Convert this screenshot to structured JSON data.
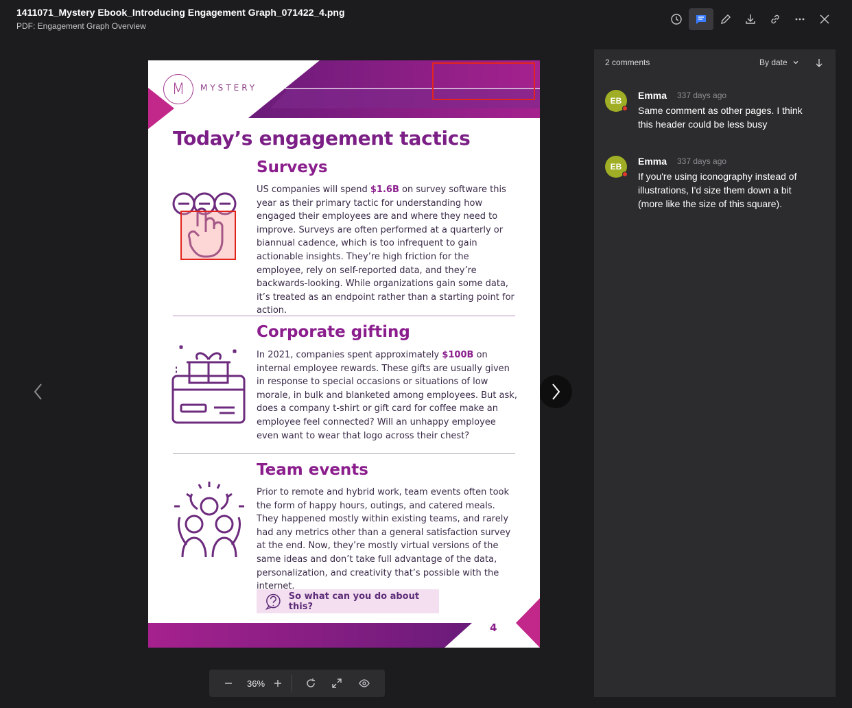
{
  "header": {
    "title": "1411071_Mystery Ebook_Introducing Engagement Graph_071422_4.png",
    "subtitle": "PDF: Engagement Graph Overview",
    "actions": [
      "history-icon",
      "comments-icon",
      "edit-icon",
      "download-icon",
      "link-icon",
      "more-icon",
      "close-icon"
    ]
  },
  "document": {
    "logo_letter": "M",
    "logo_text": "MYSTERY",
    "heading": "Today’s engagement tactics",
    "sections": [
      {
        "title": "Surveys",
        "body_before": "US companies will spend ",
        "highlight": "$1.6B",
        "body_after": " on survey software this year as their primary tactic for understanding how engaged their employees are and where they need to improve. Surveys are often performed at a quarterly or biannual cadence, which is too infrequent to gain actionable insights. They’re high friction for the employee, rely on self-reported data, and they’re backwards-looking. While organizations gain some data, it’s treated as an endpoint rather than a starting point for action."
      },
      {
        "title": "Corporate gifting",
        "body_before": "In 2021, companies spent approximately ",
        "highlight": "$100B",
        "body_after": " on internal employee rewards. These gifts are usually given in response to special occasions or situations of low morale, in bulk and blanketed among employees. But ask, does a company t-shirt or gift card for coffee make an employee feel connected? Will an unhappy employee even want to wear that logo across their chest?"
      },
      {
        "title": "Team events",
        "body": "Prior to remote and hybrid work, team events often took the form of happy hours, outings, and catered meals. They happened mostly within existing teams, and rarely had any metrics other than a general satisfaction survey at the end. Now, they’re mostly virtual versions of the same ideas and don’t take full advantage of the data, personalization, and creativity that’s possible with the internet."
      }
    ],
    "cta": "So what can you do about this?",
    "page_number": "4"
  },
  "zoom": {
    "value": "36%"
  },
  "comments_panel": {
    "count_label": "2 comments",
    "sort_label": "By date",
    "comments": [
      {
        "initials": "EB",
        "author": "Emma",
        "time": "337 days ago",
        "text": "Same comment as other pages. I think this header could be less busy"
      },
      {
        "initials": "EB",
        "author": "Emma",
        "time": "337 days ago",
        "text": "If you're using iconography instead of illustrations, I'd size them down a bit (more like the size of this square)."
      }
    ]
  },
  "colors": {
    "accent": "#8b1e8d",
    "annotation": "#e3241d",
    "avatar": "#9fae24",
    "active_button": "#3a7bff"
  }
}
